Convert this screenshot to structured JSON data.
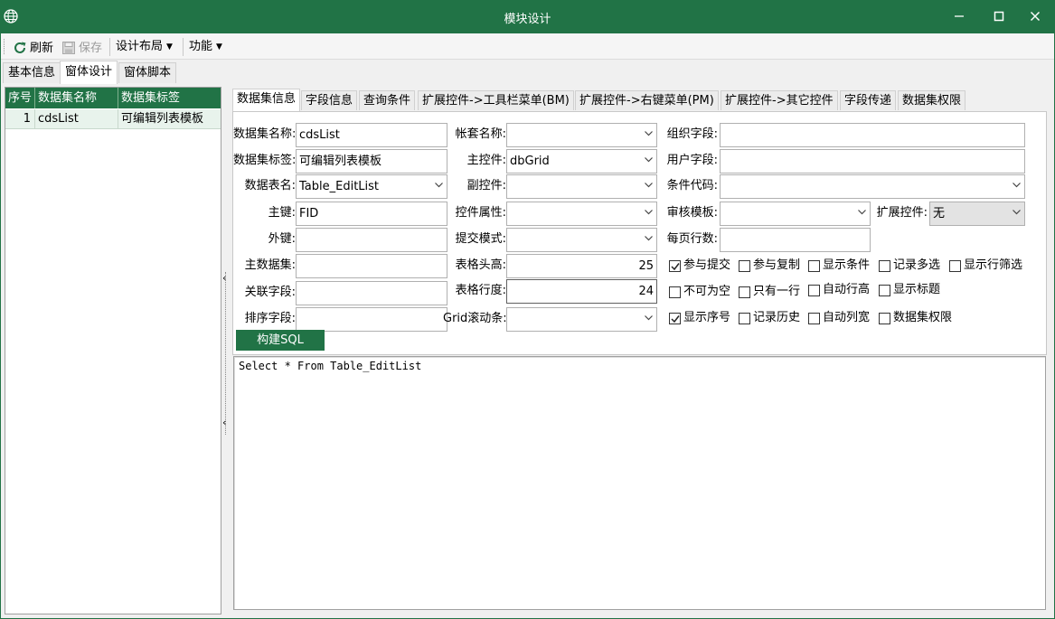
{
  "window": {
    "title": "模块设计"
  },
  "toolbar": {
    "refresh": "刷新",
    "save": "保存",
    "layout": "设计布局",
    "functions": "功能"
  },
  "top_tabs": [
    "基本信息",
    "窗体设计",
    "窗体脚本"
  ],
  "left_grid": {
    "columns": [
      "序号",
      "数据集名称",
      "数据集标签"
    ],
    "rows": [
      [
        "1",
        "cdsList",
        "可编辑列表模板"
      ]
    ]
  },
  "sub_tabs": [
    "数据集信息",
    "字段信息",
    "查询条件",
    "扩展控件->工具栏菜单(BM)",
    "扩展控件->右键菜单(PM)",
    "扩展控件->其它控件",
    "字段传递",
    "数据集权限"
  ],
  "form": {
    "col1": {
      "dataset_name_label": "数据集名称:",
      "dataset_name": "cdsList",
      "dataset_tag_label": "数据集标签:",
      "dataset_tag": "可编辑列表模板",
      "table_name_label": "数据表名:",
      "table_name": "Table_EditList",
      "primary_key_label": "主键:",
      "primary_key": "FID",
      "foreign_key_label": "外键:",
      "foreign_key": "",
      "master_dataset_label": "主数据集:",
      "master_dataset": "",
      "link_field_label": "关联字段:",
      "link_field": "",
      "sort_field_label": "排序字段:",
      "sort_field": ""
    },
    "col2": {
      "account_name_label": "帐套名称:",
      "account_name": "",
      "main_control_label": "主控件:",
      "main_control": "dbGrid",
      "sub_control_label": "副控件:",
      "sub_control": "",
      "control_props_label": "控件属性:",
      "control_props": "",
      "submit_mode_label": "提交模式:",
      "submit_mode": "",
      "header_height_label": "表格头高:",
      "header_height": "25",
      "row_height_label": "表格行度:",
      "row_height": "24",
      "grid_scroll_label": "Grid滚动条:",
      "grid_scroll": ""
    },
    "col3": {
      "org_field_label": "组织字段:",
      "org_field": "",
      "user_field_label": "用户字段:",
      "user_field": "",
      "condition_code_label": "条件代码:",
      "condition_code": "",
      "audit_template_label": "审核模板:",
      "audit_template": "",
      "ext_control_label": "扩展控件:",
      "ext_control": "无",
      "page_rows_label": "每页行数:",
      "page_rows": ""
    },
    "checkboxes": [
      {
        "label": "参与提交",
        "checked": true
      },
      {
        "label": "参与复制",
        "checked": false
      },
      {
        "label": "显示条件",
        "checked": false
      },
      {
        "label": "记录多选",
        "checked": false
      },
      {
        "label": "显示行筛选",
        "checked": false
      },
      {
        "label": "不可为空",
        "checked": false
      },
      {
        "label": "只有一行",
        "checked": false
      },
      {
        "label": "自动行高",
        "checked": false
      },
      {
        "label": "显示标题",
        "checked": false
      },
      {
        "label": "显示序号",
        "checked": true
      },
      {
        "label": "记录历史",
        "checked": false
      },
      {
        "label": "自动列宽",
        "checked": false
      },
      {
        "label": "数据集权限",
        "checked": false
      }
    ],
    "build_sql": "构建SQL"
  },
  "sql": "Select * From Table_EditList",
  "colors": {
    "accent": "#217346",
    "row_selected": "#e8f3ec"
  }
}
